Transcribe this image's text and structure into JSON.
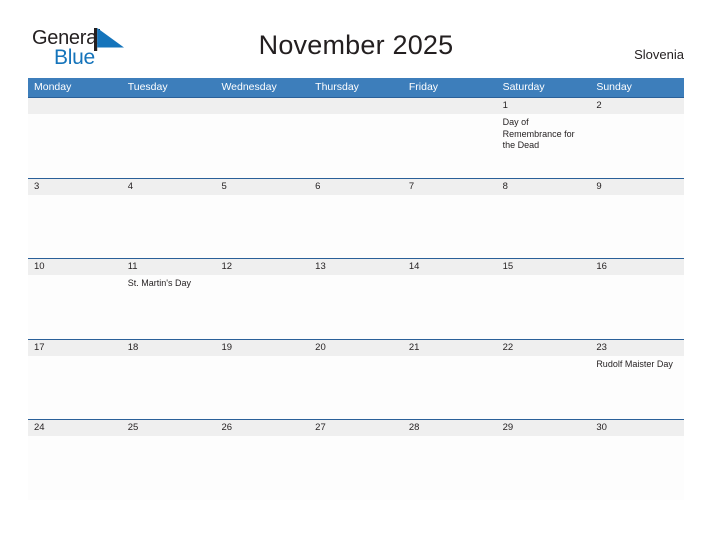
{
  "brand": {
    "name_part1": "General",
    "name_part2": "Blue",
    "flag_icon": "flag-triangle-icon",
    "blue": "#1574bb"
  },
  "header": {
    "title": "November 2025",
    "region": "Slovenia"
  },
  "calendar": {
    "header_bg": "#3d7ebb",
    "row_border": "#2a6099",
    "daynum_bg": "#efefef",
    "weekdays": [
      "Monday",
      "Tuesday",
      "Wednesday",
      "Thursday",
      "Friday",
      "Saturday",
      "Sunday"
    ],
    "weeks": [
      {
        "days": [
          {
            "num": "",
            "event": ""
          },
          {
            "num": "",
            "event": ""
          },
          {
            "num": "",
            "event": ""
          },
          {
            "num": "",
            "event": ""
          },
          {
            "num": "",
            "event": ""
          },
          {
            "num": "1",
            "event": "Day of Remembrance for the Dead"
          },
          {
            "num": "2",
            "event": ""
          }
        ]
      },
      {
        "days": [
          {
            "num": "3",
            "event": ""
          },
          {
            "num": "4",
            "event": ""
          },
          {
            "num": "5",
            "event": ""
          },
          {
            "num": "6",
            "event": ""
          },
          {
            "num": "7",
            "event": ""
          },
          {
            "num": "8",
            "event": ""
          },
          {
            "num": "9",
            "event": ""
          }
        ]
      },
      {
        "days": [
          {
            "num": "10",
            "event": ""
          },
          {
            "num": "11",
            "event": "St. Martin's Day"
          },
          {
            "num": "12",
            "event": ""
          },
          {
            "num": "13",
            "event": ""
          },
          {
            "num": "14",
            "event": ""
          },
          {
            "num": "15",
            "event": ""
          },
          {
            "num": "16",
            "event": ""
          }
        ]
      },
      {
        "days": [
          {
            "num": "17",
            "event": ""
          },
          {
            "num": "18",
            "event": ""
          },
          {
            "num": "19",
            "event": ""
          },
          {
            "num": "20",
            "event": ""
          },
          {
            "num": "21",
            "event": ""
          },
          {
            "num": "22",
            "event": ""
          },
          {
            "num": "23",
            "event": "Rudolf Maister Day"
          }
        ]
      },
      {
        "days": [
          {
            "num": "24",
            "event": ""
          },
          {
            "num": "25",
            "event": ""
          },
          {
            "num": "26",
            "event": ""
          },
          {
            "num": "27",
            "event": ""
          },
          {
            "num": "28",
            "event": ""
          },
          {
            "num": "29",
            "event": ""
          },
          {
            "num": "30",
            "event": ""
          }
        ]
      }
    ]
  }
}
